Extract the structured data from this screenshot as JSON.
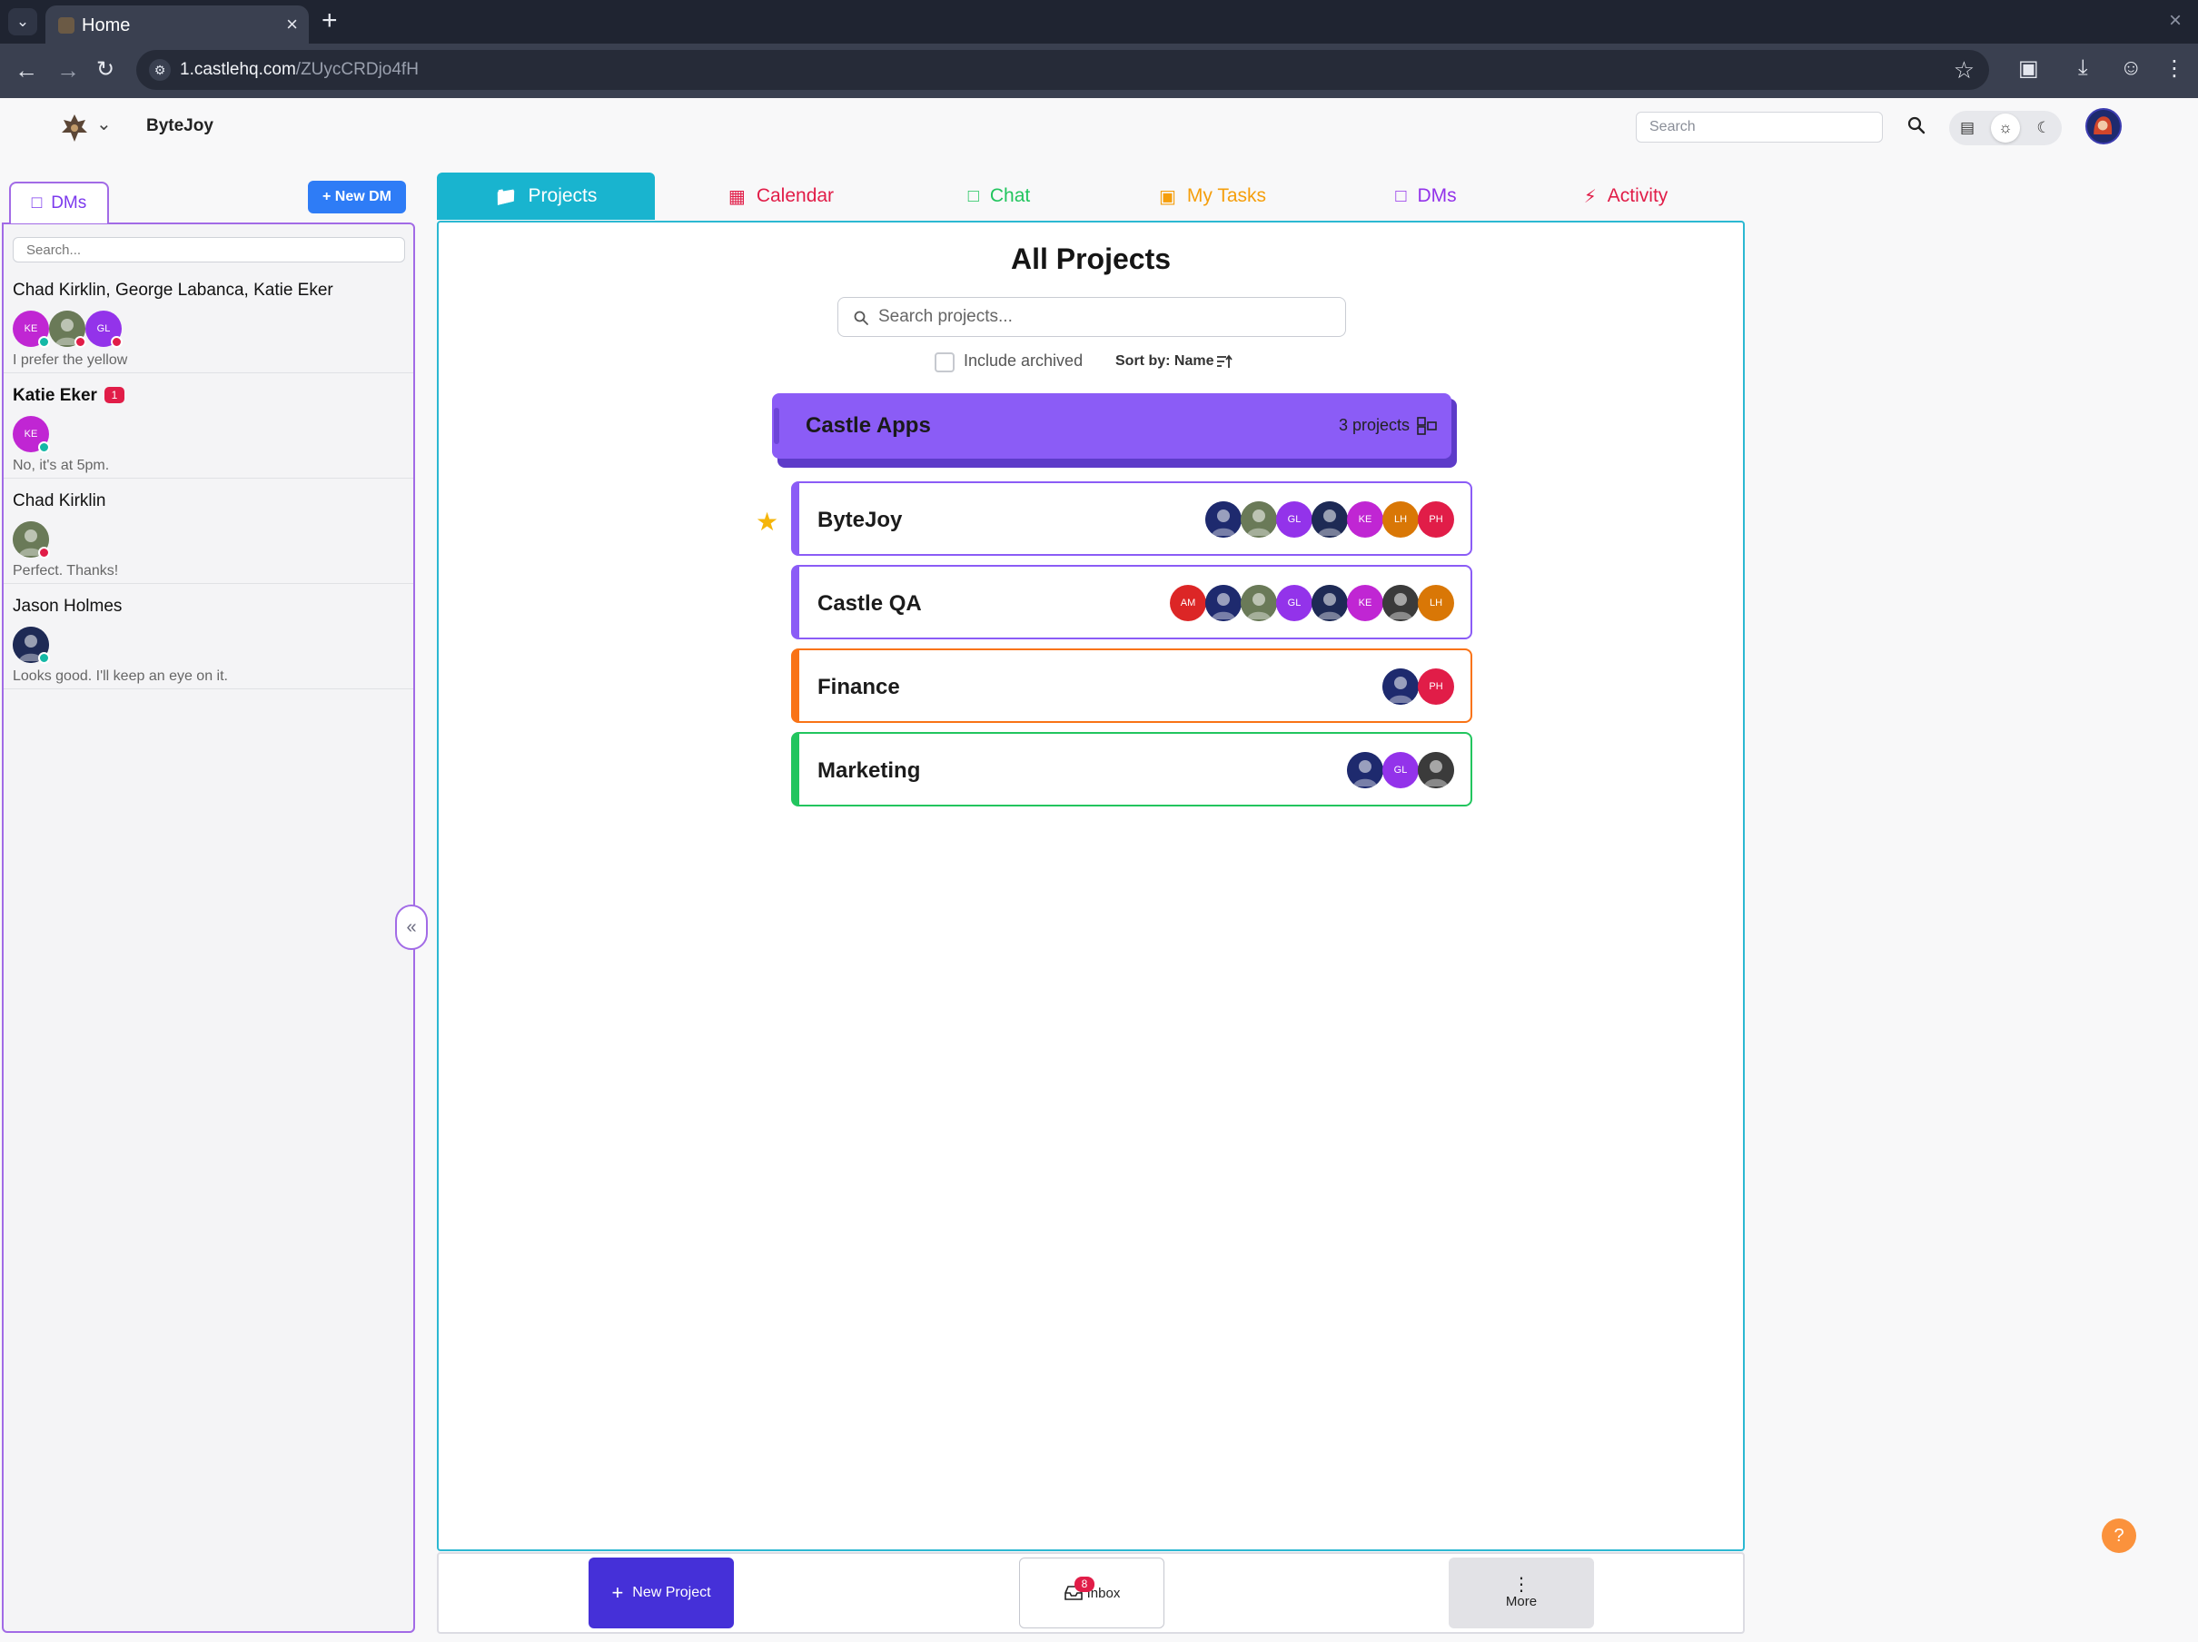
{
  "browser": {
    "tab_title": "Home",
    "url_host": "1.castlehq.com",
    "url_path": "/ZUycCRDjo4fH"
  },
  "header": {
    "workspace_name": "ByteJoy",
    "search_placeholder": "Search"
  },
  "sidebar": {
    "tab_label": "DMs",
    "new_dm_label": "+ New DM",
    "search_placeholder": "Search...",
    "conversations": [
      {
        "name": "Chad Kirklin, George Labanca, Katie Eker",
        "preview": "I prefer the yellow",
        "unread": "",
        "avatars": [
          {
            "initials": "KE",
            "color": "#c026d3",
            "status": "online"
          },
          {
            "initials": "",
            "color": "#6a7a58",
            "status": "busy",
            "photo": true
          },
          {
            "initials": "GL",
            "color": "#9333ea",
            "status": "busy"
          }
        ]
      },
      {
        "name": "Katie Eker",
        "preview": "No, it's at 5pm.",
        "unread": "1",
        "avatars": [
          {
            "initials": "KE",
            "color": "#c026d3",
            "status": "online"
          }
        ]
      },
      {
        "name": "Chad Kirklin",
        "preview": "Perfect. Thanks!",
        "unread": "",
        "avatars": [
          {
            "initials": "",
            "color": "#6a7a58",
            "status": "busy",
            "photo": true
          }
        ]
      },
      {
        "name": "Jason Holmes",
        "preview": "Looks good. I'll keep an eye on it.",
        "unread": "",
        "avatars": [
          {
            "initials": "",
            "color": "#1e2a55",
            "status": "online",
            "photo": true
          }
        ]
      }
    ]
  },
  "main_tabs": [
    {
      "label": "Projects",
      "icon": "folder-icon",
      "color": "#ffffff",
      "active": true
    },
    {
      "label": "Calendar",
      "icon": "calendar-icon",
      "color": "#e11d48",
      "active": false
    },
    {
      "label": "Chat",
      "icon": "chat-icon",
      "color": "#22c55e",
      "active": false
    },
    {
      "label": "My Tasks",
      "icon": "clipboard-icon",
      "color": "#f59e0b",
      "active": false
    },
    {
      "label": "DMs",
      "icon": "message-icon",
      "color": "#9333ea",
      "active": false
    },
    {
      "label": "Activity",
      "icon": "bolt-icon",
      "color": "#e11d48",
      "active": false
    }
  ],
  "projects": {
    "title": "All Projects",
    "search_placeholder": "Search projects...",
    "include_archived_label": "Include archived",
    "sort_label": "Sort by: Name",
    "group": {
      "name": "Castle Apps",
      "count_label": "3 projects",
      "color": "#8b5cf6"
    },
    "items": [
      {
        "name": "ByteJoy",
        "favorite": true,
        "color": "#8b5cf6",
        "members": [
          {
            "initials": "",
            "color": "#1e2a6e",
            "photo": true
          },
          {
            "initials": "",
            "color": "#6a7a58",
            "photo": true
          },
          {
            "initials": "GL",
            "color": "#9333ea"
          },
          {
            "initials": "",
            "color": "#1e2a55",
            "photo": true
          },
          {
            "initials": "KE",
            "color": "#c026d3"
          },
          {
            "initials": "LH",
            "color": "#d97706"
          },
          {
            "initials": "PH",
            "color": "#e11d48"
          }
        ]
      },
      {
        "name": "Castle QA",
        "favorite": false,
        "color": "#8b5cf6",
        "members": [
          {
            "initials": "AM",
            "color": "#dc2626"
          },
          {
            "initials": "",
            "color": "#1e2a6e",
            "photo": true
          },
          {
            "initials": "",
            "color": "#6a7a58",
            "photo": true
          },
          {
            "initials": "GL",
            "color": "#9333ea"
          },
          {
            "initials": "",
            "color": "#1e2a55",
            "photo": true
          },
          {
            "initials": "KE",
            "color": "#c026d3"
          },
          {
            "initials": "",
            "color": "#3b3b3b",
            "photo": true
          },
          {
            "initials": "LH",
            "color": "#d97706"
          }
        ]
      },
      {
        "name": "Finance",
        "favorite": false,
        "color": "#f97316",
        "members": [
          {
            "initials": "",
            "color": "#1e2a6e",
            "photo": true
          },
          {
            "initials": "PH",
            "color": "#e11d48"
          }
        ]
      },
      {
        "name": "Marketing",
        "favorite": false,
        "color": "#22c55e",
        "members": [
          {
            "initials": "",
            "color": "#1e2a6e",
            "photo": true
          },
          {
            "initials": "GL",
            "color": "#9333ea"
          },
          {
            "initials": "",
            "color": "#3b3b3b",
            "photo": true
          }
        ]
      }
    ]
  },
  "bottom_bar": {
    "new_project_label": "New Project",
    "inbox_label": "Inbox",
    "inbox_count": "8",
    "more_label": "More"
  },
  "help_label": "?"
}
